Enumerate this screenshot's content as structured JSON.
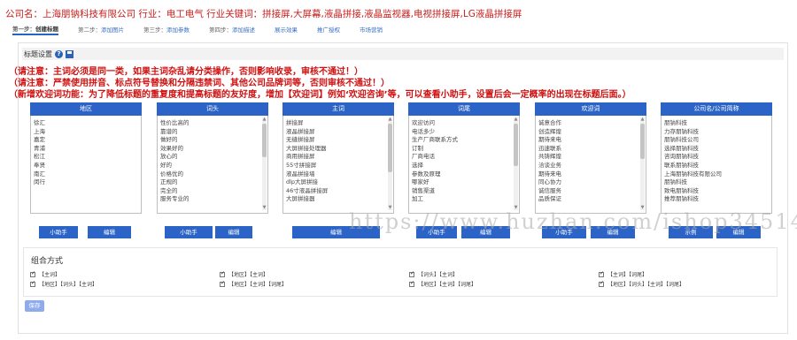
{
  "company_info": "公司名：上海朋钠科技有限公司 行业：电工电气 行业关键词：拼接屏,大屏幕,液晶拼接,液晶监视器,电视拼接屏,LG液晶拼接屏",
  "steps": [
    {
      "label": "第一步：",
      "name": "创建标题",
      "active": true
    },
    {
      "label": "第二步：",
      "name": "添加图片",
      "active": false
    },
    {
      "label": "第三步：",
      "name": "添加参数",
      "active": false
    },
    {
      "label": "第四步：",
      "name": "添加描述",
      "active": false
    },
    {
      "label": "",
      "name": "展示效果",
      "active": false
    },
    {
      "label": "",
      "name": "推广授权",
      "active": false
    },
    {
      "label": "",
      "name": "市场营销",
      "active": false
    }
  ],
  "panel_title": "标题设置",
  "icons": {
    "help": "question-circle-icon",
    "save": "floppy-save-icon"
  },
  "notices": [
    "（请注意：主词必须是同一类，如果主词杂乱请分类操作，否则影响收录，审核不通过！）",
    "（请注意：严禁使用拼音、标点符号替换和分隔违禁词、其他公司品牌词等，否则审核不通过！）",
    "（新增欢迎词功能：为了降低标题的重复度和提高标题的友好度，增加【欢迎词】例如‘欢迎咨询’等，可以查看小助手，设置后会一定概率的出现在标题后面。）"
  ],
  "columns": [
    {
      "header": "地区",
      "items": [
        "徐汇",
        "上海",
        "嘉定",
        "青浦",
        "松江",
        "奉贤",
        "南汇",
        "闵行"
      ]
    },
    {
      "header": "词头",
      "items": [
        "性价比高的",
        "靠谱的",
        "做好的",
        "效果好的",
        "放心的",
        "好的",
        "价格优的",
        "正规的",
        "完全的",
        "服务专业的"
      ]
    },
    {
      "header": "主词",
      "items": [
        "拼接屏",
        "液晶拼接屏",
        "无缝拼接屏",
        "大屏拼接处理器",
        "商用拼接屏",
        "55寸拼接屏",
        "液晶拼接墙",
        "dlp大屏拼接",
        "46寸液晶拼接屏",
        "大屏拼接器"
      ]
    },
    {
      "header": "词尾",
      "items": [
        "欢迎访问",
        "电话多少",
        "生产厂商联系方式",
        "订制",
        "厂商电话",
        "选择",
        "参数及原理",
        "哪家好",
        "销售渠道",
        "加工"
      ]
    },
    {
      "header": "欢迎词",
      "items": [
        "诚意合作",
        "创造辉煌",
        "期待来电",
        "迅速联系",
        "共铸辉煌",
        "洽谈业务",
        "期待来电",
        "同心协力",
        "诚信服务",
        "品质保证"
      ]
    },
    {
      "header": "公司名/公司简称",
      "items": [
        "朋钠科技",
        "力存朋钠科技",
        "朋钠科技公司",
        "选择朋钠科技",
        "咨询朋钠科技",
        "联系朋钠科技",
        "上海朋钠科技有限公司",
        "朋钠科技",
        "致电朋钠科技",
        "推荐朋钠科技"
      ]
    }
  ],
  "buttons": {
    "helper": "小助手",
    "edit": "编辑",
    "example": "示例"
  },
  "combo": {
    "title": "组合方式",
    "rows": [
      [
        "【主词】",
        "【地区】【主词】",
        "【词头】【主词】",
        "【主词】【词尾】"
      ],
      [
        "【地区】【词头】【主词】",
        "【地区】【主词】【词尾】",
        "【地区】【主词】【词尾】",
        "【地区】【词头】【主词】【词尾】"
      ]
    ]
  },
  "submit_label": "保存",
  "watermark": "https://www.huzhan.com/ishop34514"
}
